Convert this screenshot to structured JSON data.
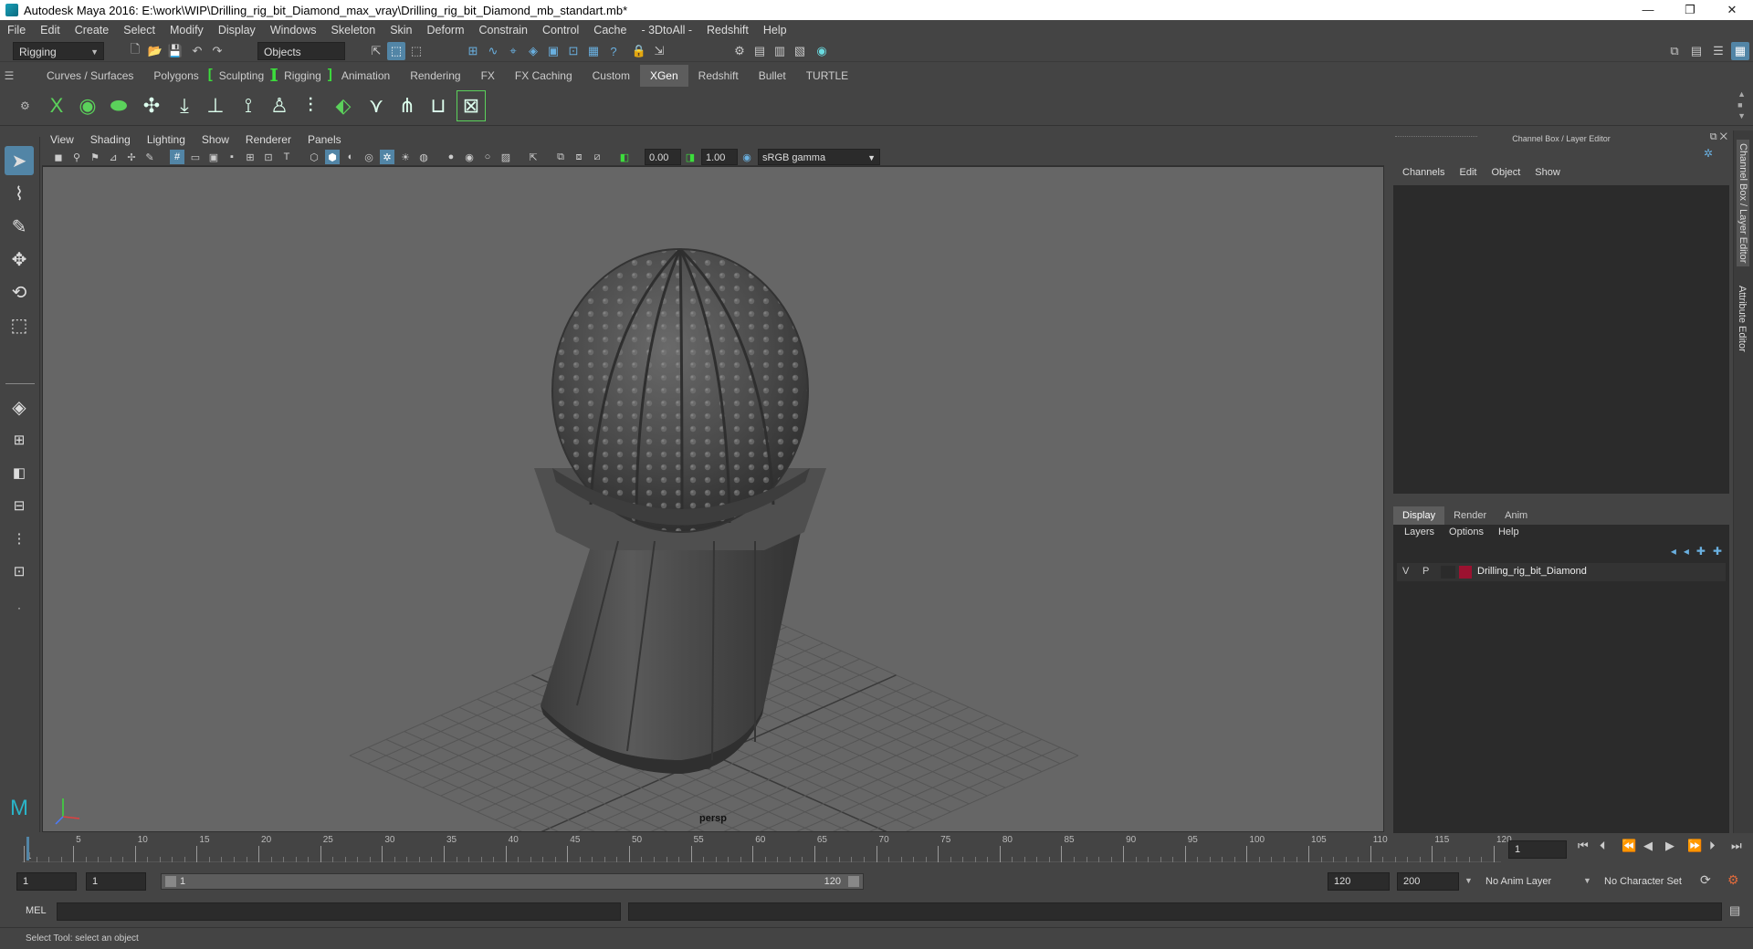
{
  "window": {
    "title": "Autodesk Maya 2016: E:\\work\\WIP\\Drilling_rig_bit_Diamond_max_vray\\Drilling_rig_bit_Diamond_mb_standart.mb*",
    "minimize": "—",
    "restore": "❐",
    "close": "✕"
  },
  "menubar": [
    "File",
    "Edit",
    "Create",
    "Select",
    "Modify",
    "Display",
    "Windows",
    "Skeleton",
    "Skin",
    "Deform",
    "Constrain",
    "Control",
    "Cache",
    "- 3DtoAll -",
    "Redshift",
    "Help"
  ],
  "statusline": {
    "mode": "Rigging",
    "selection_mode": "Objects"
  },
  "shelf_tabs": [
    {
      "label": "Curves / Surfaces",
      "active": false,
      "bracket": false
    },
    {
      "label": "Polygons",
      "active": false,
      "bracket": false
    },
    {
      "label": "Sculpting",
      "active": false,
      "bracket": true
    },
    {
      "label": "Rigging",
      "active": false,
      "bracket": true
    },
    {
      "label": "Animation",
      "active": false,
      "bracket": false
    },
    {
      "label": "Rendering",
      "active": false,
      "bracket": false
    },
    {
      "label": "FX",
      "active": false,
      "bracket": false
    },
    {
      "label": "FX Caching",
      "active": false,
      "bracket": false
    },
    {
      "label": "Custom",
      "active": false,
      "bracket": false
    },
    {
      "label": "XGen",
      "active": true,
      "bracket": false
    },
    {
      "label": "Redshift",
      "active": false,
      "bracket": false
    },
    {
      "label": "Bullet",
      "active": false,
      "bracket": false
    },
    {
      "label": "TURTLE",
      "active": false,
      "bracket": false
    }
  ],
  "viewport": {
    "menu": [
      "View",
      "Shading",
      "Lighting",
      "Show",
      "Renderer",
      "Panels"
    ],
    "exposure": "0.00",
    "gamma": "1.00",
    "color_space": "sRGB gamma",
    "camera_label": "persp"
  },
  "channel_box": {
    "title": "Channel Box / Layer Editor",
    "menu": [
      "Channels",
      "Edit",
      "Object",
      "Show"
    ],
    "layer_tabs": [
      "Display",
      "Render",
      "Anim"
    ],
    "active_layer_tab": "Display",
    "layer_menu": [
      "Layers",
      "Options",
      "Help"
    ],
    "layer": {
      "v": "V",
      "p": "P",
      "name": "Drilling_rig_bit_Diamond",
      "color": "#9b1230"
    }
  },
  "right_tabs": {
    "channel_box": "Channel Box / Layer Editor",
    "attribute_editor": "Attribute Editor"
  },
  "timeline": {
    "ticks": [
      "1",
      "5",
      "10",
      "15",
      "20",
      "25",
      "30",
      "35",
      "40",
      "45",
      "50",
      "55",
      "60",
      "65",
      "70",
      "75",
      "80",
      "85",
      "90",
      "95",
      "100",
      "105",
      "110",
      "115",
      "120"
    ],
    "current_frame": "1"
  },
  "range": {
    "start": "1",
    "start_inner": "1",
    "range_start_label": "1",
    "range_end_label": "120",
    "end_inner": "120",
    "end": "200",
    "anim_layer": "No Anim Layer",
    "character_set": "No Character Set"
  },
  "cmdline": {
    "label": "MEL"
  },
  "helpline": {
    "text": "Select Tool: select an object"
  },
  "colors": {
    "accent": "#5285a6",
    "bracket": "#3cdd3c",
    "layer_color": "#9b1230"
  }
}
